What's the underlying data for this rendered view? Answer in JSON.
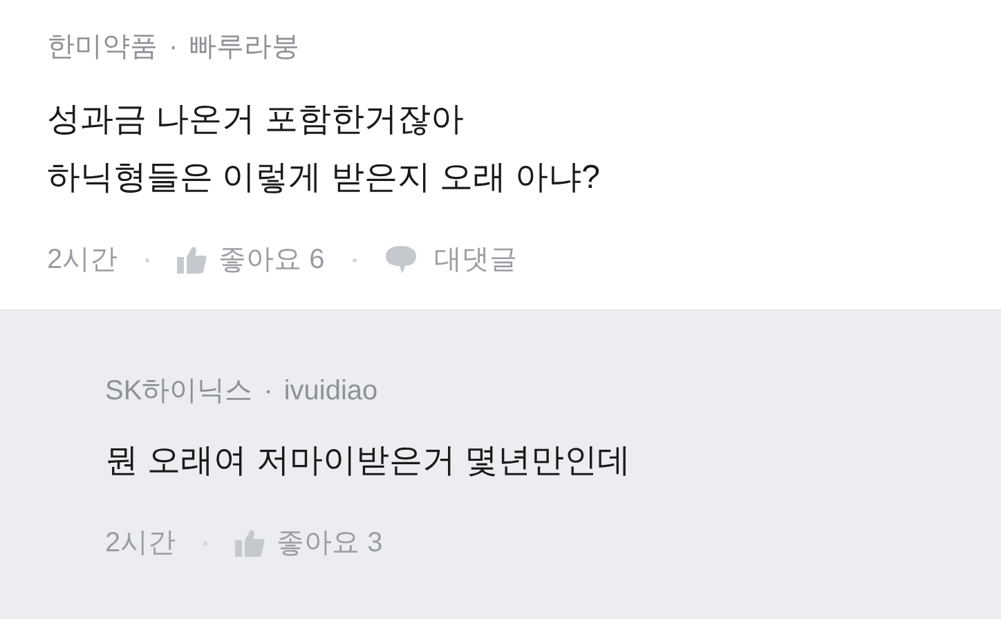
{
  "comments": [
    {
      "kind": "comment",
      "company": "한미약품",
      "separator": "·",
      "author": "빠루라붕",
      "lines": [
        "성과금 나온거 포함한거잖아",
        "하닉형들은 이렇게 받은지 오래 아냐?"
      ],
      "time": "2시간",
      "likes": "좋아요 6",
      "reply_action": "대댓글"
    },
    {
      "kind": "reply",
      "company": "SK하이닉스",
      "separator": "·",
      "author": "ivuidiao",
      "lines": [
        "뭔 오래여 저마이받은거 몇년만인데"
      ],
      "time": "2시간",
      "likes": "좋아요 3"
    }
  ]
}
